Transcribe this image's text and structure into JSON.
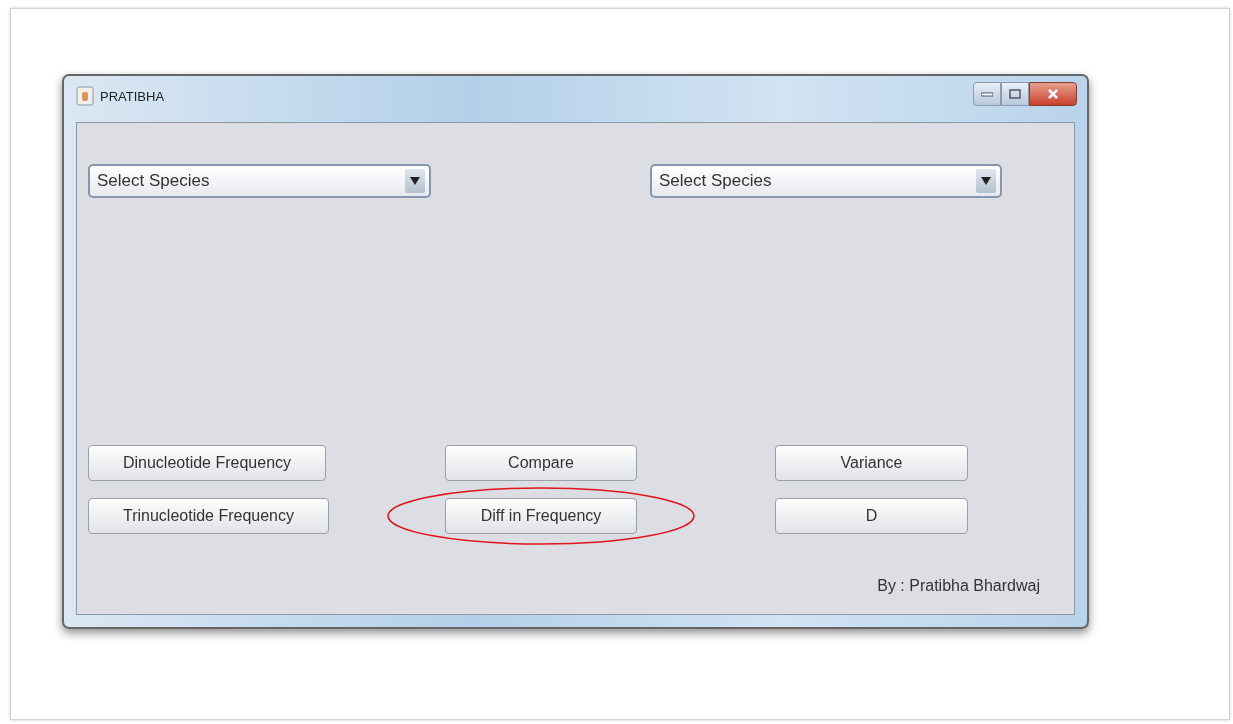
{
  "window": {
    "title": "PRATIBHA"
  },
  "combos": [
    {
      "value": "Select Species"
    },
    {
      "value": "Select Species"
    }
  ],
  "button_rows": [
    [
      {
        "label": "Dinucleotide Frequency",
        "circled": false
      },
      {
        "label": "Compare",
        "circled": false
      },
      {
        "label": "Variance",
        "circled": false
      }
    ],
    [
      {
        "label": "Trinucleotide Frequency",
        "circled": false
      },
      {
        "label": "Diff in Frequency",
        "circled": true
      },
      {
        "label": "D",
        "circled": false
      }
    ]
  ],
  "credit": "By : Pratibha Bhardwaj"
}
